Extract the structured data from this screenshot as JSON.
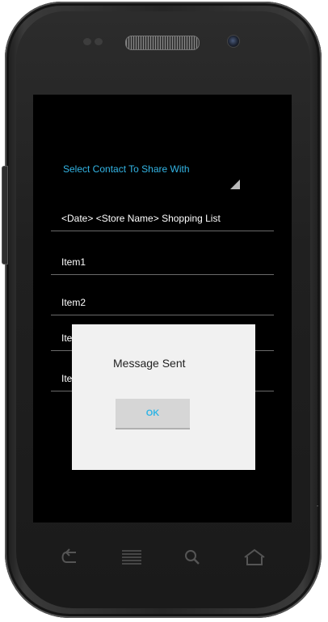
{
  "share": {
    "select_contact_label": "Select Contact To Share With"
  },
  "list": {
    "title_row": "<Date> <Store Name> Shopping List",
    "items": [
      "Item1",
      "Item2",
      "Item3",
      "Item4"
    ]
  },
  "dialog": {
    "message": "Message Sent",
    "ok_label": "OK"
  },
  "colors": {
    "accent": "#33b5e5",
    "screen_bg": "#000000",
    "dialog_bg": "#f1f1f1"
  },
  "nav_icons": [
    "back-icon",
    "menu-icon",
    "search-icon",
    "home-icon"
  ]
}
